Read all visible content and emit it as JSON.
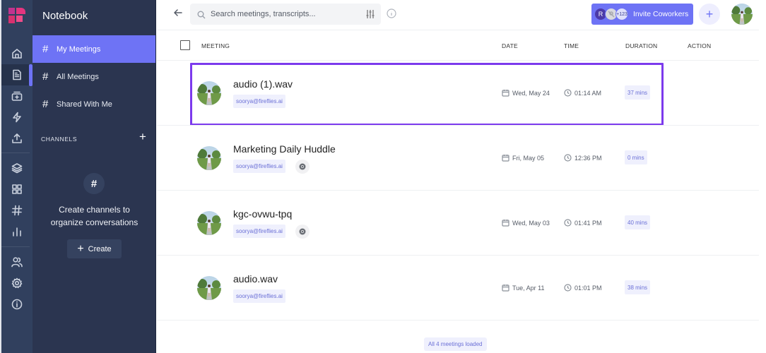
{
  "rail": {
    "items": [
      {
        "name": "home-icon"
      },
      {
        "name": "notebook-icon",
        "active": true
      },
      {
        "name": "meeting-recorder-icon"
      },
      {
        "name": "integrations-icon"
      },
      {
        "name": "upload-icon"
      },
      {
        "name": "layers-icon"
      },
      {
        "name": "apps-icon"
      },
      {
        "name": "channels-icon"
      },
      {
        "name": "analytics-icon"
      },
      {
        "name": "team-icon"
      },
      {
        "name": "settings-icon"
      },
      {
        "name": "info-icon"
      }
    ]
  },
  "sidebar": {
    "title": "Notebook",
    "nav": [
      {
        "label": "My Meetings",
        "selected": true
      },
      {
        "label": "All Meetings",
        "selected": false
      },
      {
        "label": "Shared With Me",
        "selected": false
      }
    ],
    "channels_label": "CHANNELS",
    "channels_add": "+",
    "empty_icon": "#",
    "empty_text_line1": "Create channels to",
    "empty_text_line2": "organize conversations",
    "create_label": "Create"
  },
  "topbar": {
    "search_placeholder": "Search meetings, transcripts...",
    "search_value": "",
    "invite": {
      "avatar_initial": "R",
      "more_count": "+123",
      "label": "Invite Coworkers"
    },
    "add_button": "+"
  },
  "table": {
    "headers": {
      "meeting": "MEETING",
      "date": "DATE",
      "time": "TIME",
      "duration": "DURATION",
      "action": "ACTION"
    },
    "rows": [
      {
        "title": "audio (1).wav",
        "owner": "soorya@fireflies.ai",
        "platform": "",
        "date": "Wed, May 24",
        "time": "01:14 AM",
        "duration": "37 mins",
        "highlighted": true
      },
      {
        "title": "Marketing Daily Huddle",
        "owner": "soorya@fireflies.ai",
        "platform": "chrome",
        "date": "Fri, May 05",
        "time": "12:36 PM",
        "duration": "0 mins",
        "highlighted": false
      },
      {
        "title": "kgc-ovwu-tpq",
        "owner": "soorya@fireflies.ai",
        "platform": "chrome",
        "date": "Wed, May 03",
        "time": "01:41 PM",
        "duration": "40 mins",
        "highlighted": false
      },
      {
        "title": "audio.wav",
        "owner": "soorya@fireflies.ai",
        "platform": "",
        "date": "Tue, Apr 11",
        "time": "01:01 PM",
        "duration": "38 mins",
        "highlighted": false
      }
    ],
    "footer": "All 4 meetings loaded"
  },
  "colors": {
    "accent": "#6e73f5",
    "highlight_border": "#7c3aed",
    "rail_bg": "#31405e",
    "sidebar_bg": "#2b3550"
  }
}
